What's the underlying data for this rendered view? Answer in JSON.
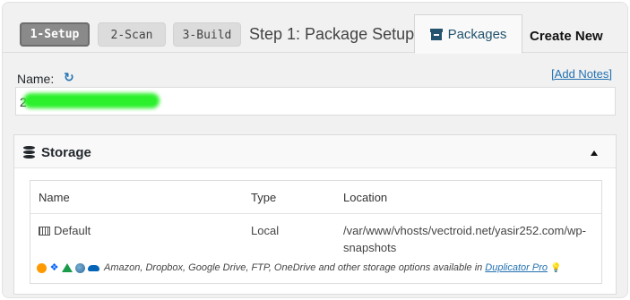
{
  "header": {
    "steps": [
      {
        "label": "1-Setup",
        "active": true
      },
      {
        "label": "2-Scan",
        "active": false
      },
      {
        "label": "3-Build",
        "active": false
      }
    ],
    "title": "Step 1: Package Setup",
    "tabs": {
      "packages": "Packages",
      "create_new": "Create New"
    }
  },
  "name_field": {
    "label": "Name:",
    "add_notes_link": "[Add Notes]",
    "value_prefix": "2",
    "value_redacted": true
  },
  "storage": {
    "title": "Storage",
    "columns": [
      "Name",
      "Type",
      "Location"
    ],
    "rows": [
      {
        "name": "Default",
        "type": "Local",
        "location": "/var/www/vhosts/vectroid.net/yasir252.com/wp-snapshots"
      }
    ],
    "providers_text": "Amazon, Dropbox, Google Drive, FTP, OneDrive and other storage options available in",
    "providers_link": "Duplicator Pro",
    "provider_icons": [
      "amazon-icon",
      "dropbox-icon",
      "google-drive-icon",
      "ftp-icon",
      "onedrive-icon"
    ]
  },
  "colors": {
    "accent": "#2271b1",
    "tab_text": "#23536e",
    "step_active": "#8a8a8a",
    "step_inactive": "#dcdcdc",
    "redaction": "#2bf02b"
  }
}
